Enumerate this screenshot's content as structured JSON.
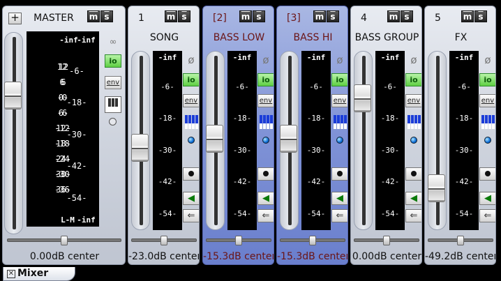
{
  "master": {
    "plus_label": "+",
    "title": "MASTER",
    "m": "m",
    "s": "s",
    "top_left": "-inf",
    "top_right": "-inf",
    "left_scale": [
      "12",
      "6",
      "0-",
      "6-",
      "12-",
      "18-",
      "24-",
      "30-",
      "36-"
    ],
    "right_scale": [
      "12",
      "6",
      "-0",
      "-6",
      "-12",
      "-18",
      "-24",
      "-30",
      "-36"
    ],
    "mid_scale": [
      "-6-",
      "-18-",
      "-30-",
      "-42-",
      "-54-"
    ],
    "bottom_left": "L-M",
    "bottom_right": "-inf",
    "value": "0.00dB center",
    "io": "io",
    "env": "env"
  },
  "strips": [
    {
      "num": "1",
      "name": "SONG",
      "top": "-inf",
      "value": "-23.0dB center",
      "selected": false,
      "fader": 0.53
    },
    {
      "num": "[2]",
      "name": "BASS LOW",
      "top": "-inf",
      "value": "-15.3dB center",
      "selected": true,
      "fader": 0.47
    },
    {
      "num": "[3]",
      "name": "BASS HI",
      "top": "-inf",
      "value": "-15.3dB center",
      "selected": true,
      "fader": 0.47
    },
    {
      "num": "4",
      "name": "BASS GROUP",
      "top": "-inf",
      "value": "0.00dB center",
      "selected": false,
      "fader": 0.2
    },
    {
      "num": "5",
      "name": "FX",
      "top": "-inf",
      "value": "-49.2dB center",
      "selected": false,
      "fader": 0.8
    }
  ],
  "scale": [
    "-6-",
    "-18-",
    "-30-",
    "-42-",
    "-54-"
  ],
  "labels": {
    "m": "m",
    "s": "s",
    "io": "io",
    "env": "env",
    "null": "ø",
    "speaker": "◀",
    "arrow": "⇐"
  },
  "tab": {
    "label": "Mixer"
  }
}
